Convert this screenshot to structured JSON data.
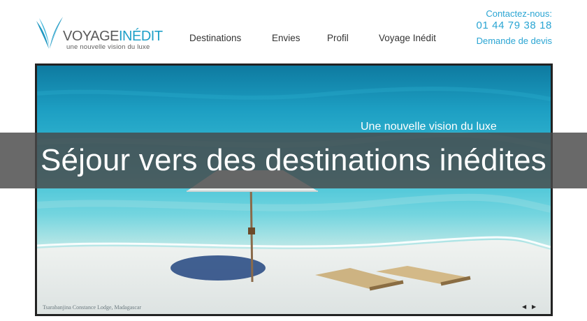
{
  "header": {
    "logo": {
      "name_part1": "VOYAGE",
      "name_part2": "INÉDIT",
      "tagline": "une nouvelle vision du luxe"
    },
    "nav": [
      {
        "label": "Destinations"
      },
      {
        "label": "Envies"
      },
      {
        "label": "Profil"
      },
      {
        "label": "Voyage Inédit"
      }
    ],
    "contact": {
      "label": "Contactez-nous:",
      "phone": "01 44 79 38 18",
      "quote_link": "Demande de devis"
    }
  },
  "hero": {
    "slogan": "Une nouvelle vision du luxe",
    "caption": "Tsarabanjina Constance Lodge, Madagascar",
    "prev_arrow": "◀",
    "next_arrow": "▶"
  },
  "banner": {
    "title": "Séjour vers des destinations inédites"
  },
  "colors": {
    "accent": "#2aa5d3",
    "logo_blue": "#1ea0c8",
    "banner_overlay": "#484848"
  },
  "icons": {
    "logo_mark": "v-wave-logo-icon",
    "prev": "arrow-left-icon",
    "next": "arrow-right-icon"
  }
}
